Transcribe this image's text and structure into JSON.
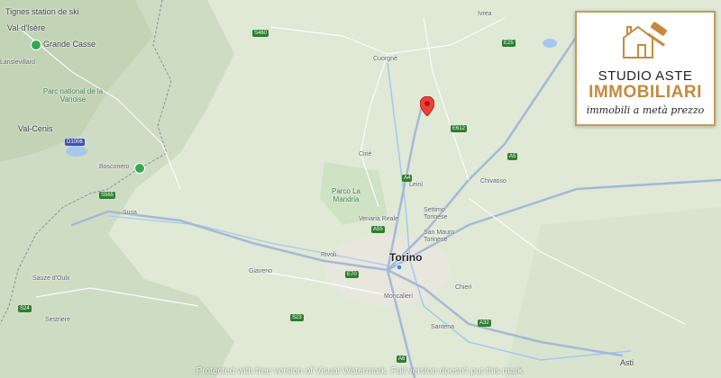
{
  "map": {
    "places": {
      "tignes": "Tignes station de ski",
      "val_disere": "Val-d'Isère",
      "grande_casse": "Grande Casse",
      "lanslevillard": "Lanslevillard",
      "parc_vanoise": "Parc national de la Vanoise",
      "val_cenis": "Val-Cenis",
      "bosco": "Bosconero",
      "ivrea": "Ivrea",
      "cuorgne": "Cuorgnè",
      "cirie": "Ciriè",
      "leini": "Leinì",
      "chivasso": "Chivasso",
      "settimo": "Settimo Torinese",
      "venaria": "Venaria Reale",
      "san_mauro": "San Mauro Torinese",
      "rivoli": "Rivoli",
      "torino": "Torino",
      "giaveno": "Giaveno",
      "susa": "Susa",
      "sauze": "Sauze d'Oulx",
      "sestriere": "Sestriere",
      "moncalieri": "Moncalieri",
      "chieri": "Chieri",
      "santena": "Santena",
      "asti": "Asti",
      "parco_mandria": "Parco La Mandria"
    },
    "roads": {
      "s460": "S460",
      "e25": "E25",
      "a5": "A5",
      "e612": "E612",
      "a4": "A4",
      "s565": "S565",
      "a55": "A55",
      "e70": "E70",
      "a32": "A32",
      "s24": "S24",
      "d1006": "D1006",
      "s23": "S23",
      "a6": "A6"
    },
    "pin_label": "Property location marker"
  },
  "logo": {
    "line1": "STUDIO ASTE",
    "line2": "IMMOBILIARI",
    "line3": "immobili a metà prezzo"
  },
  "watermark": "Protected with free version of Visual Watermark. Full version doesn't put this mark.",
  "colors": {
    "land": "#dfe9d6",
    "mountain": "#c9d8bf",
    "road_major": "#a7b8d6",
    "road_minor": "#ffffff",
    "pin": "#ea4335",
    "logo_gold": "#c58a3e"
  }
}
